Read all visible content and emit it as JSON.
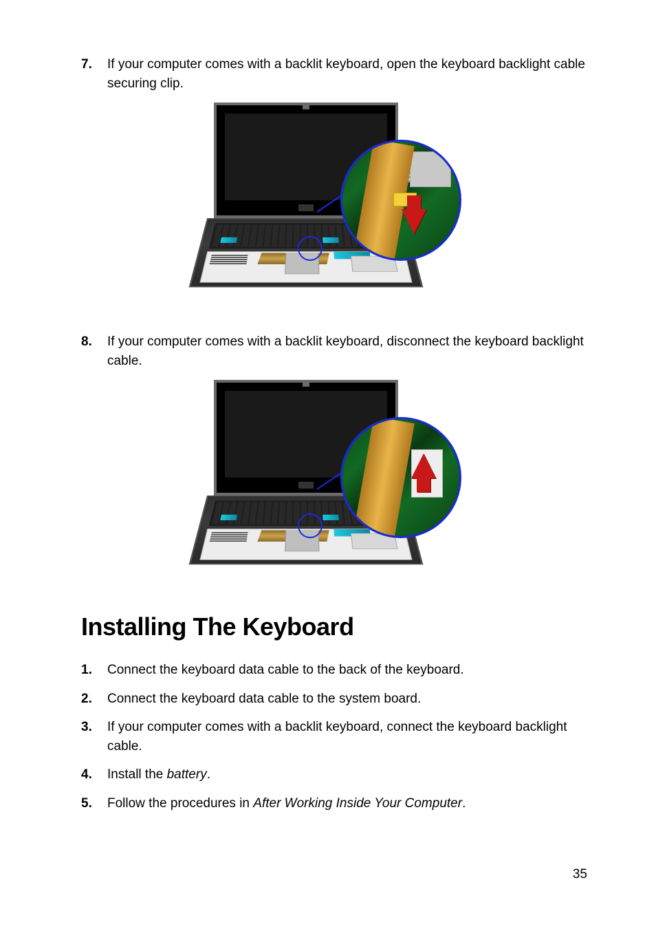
{
  "steps_a": [
    {
      "num": "7.",
      "text": "If your computer comes with a backlit keyboard, open the keyboard backlight cable securing clip."
    },
    {
      "num": "8.",
      "text": "If your computer comes with a backlit keyboard, disconnect the keyboard backlight cable."
    }
  ],
  "section_heading": "Installing The Keyboard",
  "steps_b": [
    {
      "num": "1.",
      "text": "Connect the keyboard data cable to the back of the keyboard."
    },
    {
      "num": "2.",
      "text": "Connect the keyboard data cable to the system board."
    },
    {
      "num": "3.",
      "text": "If your computer comes with a backlit keyboard, connect the keyboard backlight cable."
    },
    {
      "num": "4.",
      "prefix": "Install the ",
      "link": "battery",
      "suffix": "."
    },
    {
      "num": "5.",
      "prefix": "Follow the procedures in ",
      "link": "After Working Inside Your Computer",
      "suffix": "."
    }
  ],
  "page_number": "35"
}
